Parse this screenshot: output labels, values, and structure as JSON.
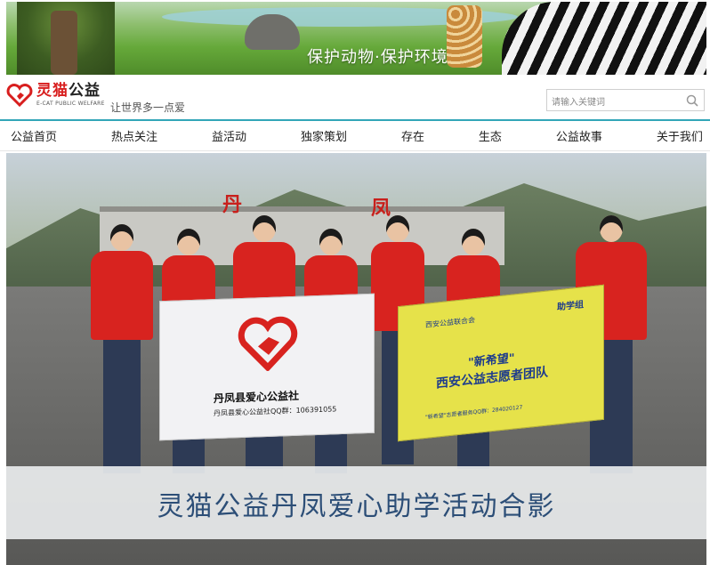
{
  "banner": {
    "slogan": "保护动物·保护环境"
  },
  "header": {
    "logo_cn_red": "灵猫",
    "logo_cn_dark": "公益",
    "logo_en": "E-CAT PUBLIC WELFARE",
    "tagline": "让世界多一点爱",
    "search_placeholder": "请输入关键词"
  },
  "nav": {
    "items": [
      "公益首页",
      "热点关注",
      "益活动",
      "独家策划",
      "存在",
      "生态",
      "公益故事",
      "关于我们"
    ]
  },
  "photo": {
    "gate_sign_1": "丹",
    "gate_sign_2": "凤",
    "white_banner_title": "丹凤县爱心公益社",
    "white_banner_sub": "丹凤县爱心公益社QQ群：106391055",
    "yellow_banner_corner": "助学组",
    "yellow_banner_top": "西安公益联合会",
    "yellow_banner_line1": "\"新希望\"",
    "yellow_banner_line2": "西安公益志愿者团队",
    "yellow_banner_foot": "\"新希望\"志愿者服务QQ群：284020127",
    "caption": "灵猫公益丹凤爱心助学活动合影"
  },
  "colors": {
    "brand_red": "#d81e1e",
    "nav_accent": "#32a6b8",
    "caption_blue": "#2c4e77"
  }
}
